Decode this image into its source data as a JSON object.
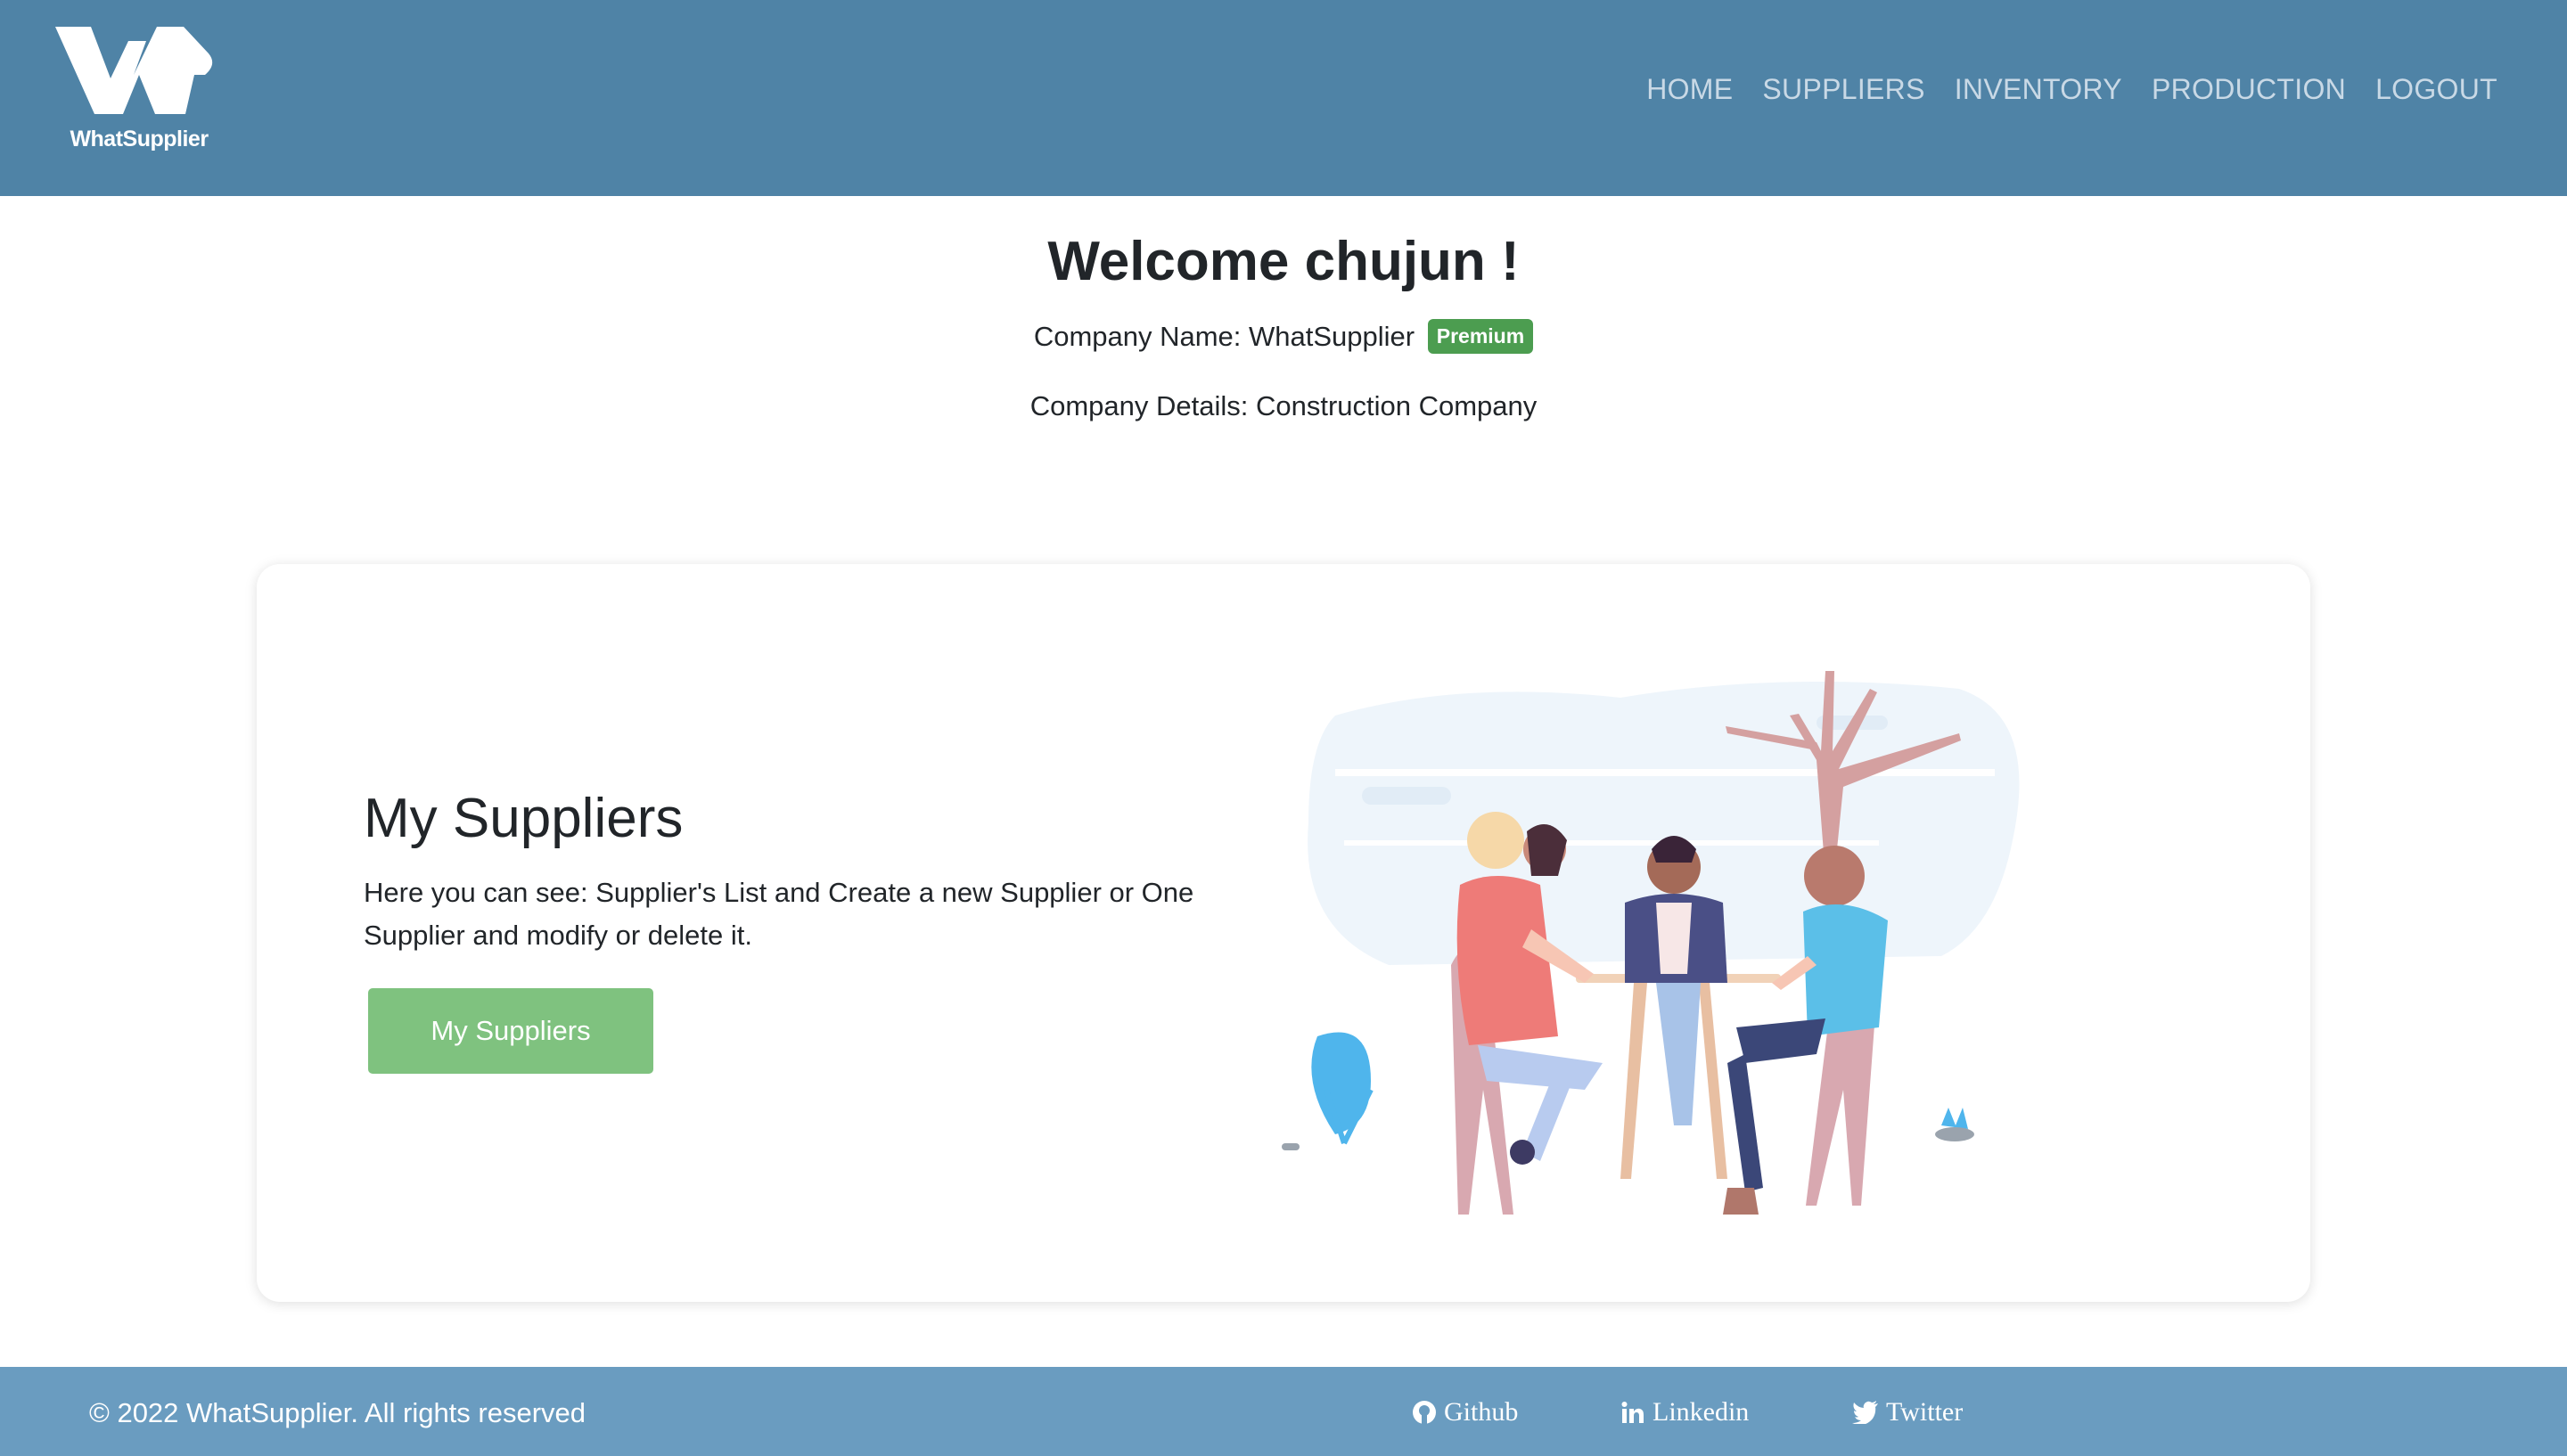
{
  "header": {
    "logo_text": "WhatSupplier",
    "nav": [
      "HOME",
      "SUPPLIERS",
      "INVENTORY",
      "PRODUCTION",
      "LOGOUT"
    ]
  },
  "welcome": {
    "title": "Welcome chujun !",
    "company_name_label": "Company Name: WhatSupplier",
    "badge": "Premium",
    "company_details": "Company Details: Construction Company"
  },
  "card": {
    "title": "My Suppliers",
    "text": "Here you can see: Supplier's List and Create a new Supplier or One Supplier and modify or delete it.",
    "button": "My Suppliers"
  },
  "footer": {
    "copyright": "© 2022 WhatSupplier. All rights reserved",
    "links": [
      "Github",
      "Linkedin",
      "Twitter"
    ]
  },
  "colors": {
    "header": "#4f83a6",
    "footer": "#6a9cc0",
    "badge": "#4c9d50",
    "button": "#7fc27f"
  }
}
